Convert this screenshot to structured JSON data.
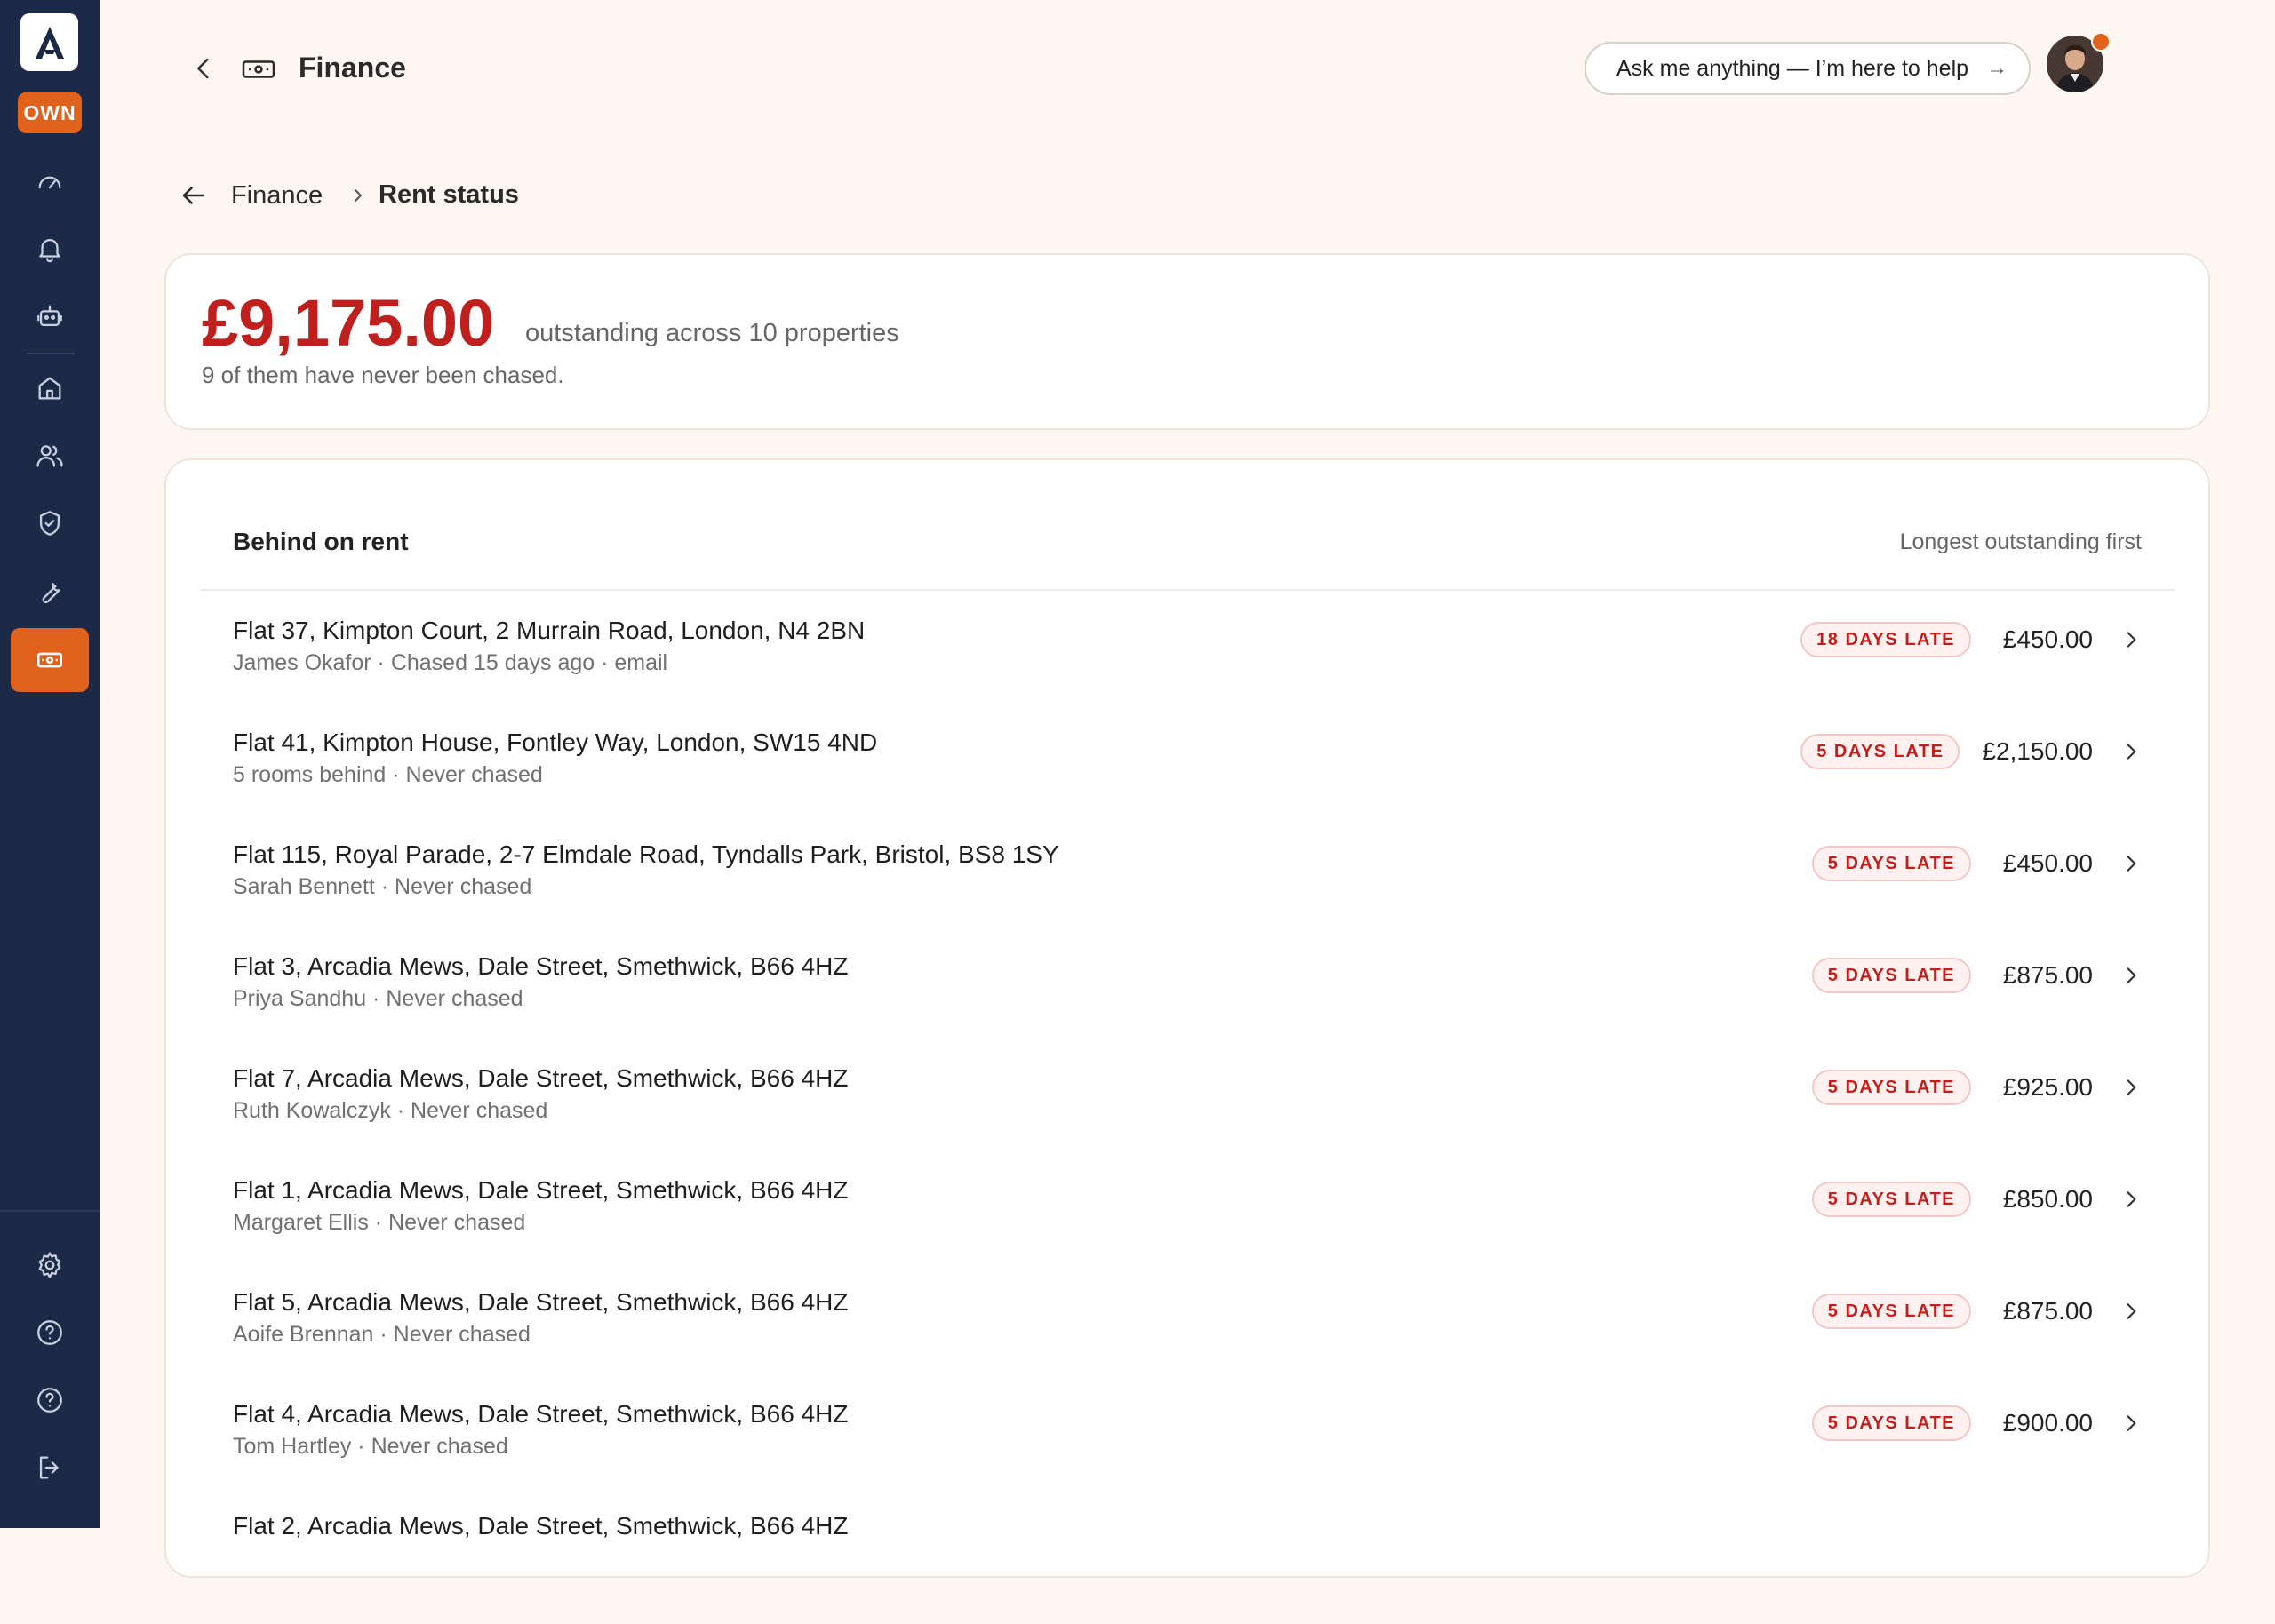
{
  "app": {
    "logo_letter": "A",
    "badge": "OWN"
  },
  "sidebar": {
    "icons": [
      "dashboard-icon",
      "bell-icon",
      "robot-icon",
      "home-icon",
      "people-icon",
      "shield-icon",
      "wrench-icon",
      "money-icon",
      "settings-icon",
      "help-icon",
      "help-icon",
      "logout-icon"
    ],
    "active": "money-icon"
  },
  "header": {
    "title": "Finance",
    "ask_label": "Ask me anything — I’m here to help",
    "ask_arrow": "→"
  },
  "breadcrumb": {
    "parent": "Finance",
    "current": "Rent status"
  },
  "summary": {
    "amount": "£9,175.00",
    "across": "outstanding across 10 properties",
    "note": "9 of them have never been chased."
  },
  "list": {
    "title": "Behind on rent",
    "sort": "Longest outstanding first",
    "rows": [
      {
        "address": "Flat 37, Kimpton Court, 2 Murrain Road, London, N4 2BN",
        "sub": "James Okafor · Chased 15 days ago · email",
        "badge": "18 DAYS LATE",
        "amount": "£450.00"
      },
      {
        "address": "Flat 41, Kimpton House, Fontley Way, London, SW15 4ND",
        "sub": "5 rooms behind · Never chased",
        "badge": "5 DAYS LATE",
        "amount": "£2,150.00"
      },
      {
        "address": "Flat 115, Royal Parade, 2-7 Elmdale Road, Tyndalls Park, Bristol, BS8 1SY",
        "sub": "Sarah Bennett · Never chased",
        "badge": "5 DAYS LATE",
        "amount": "£450.00"
      },
      {
        "address": "Flat 3, Arcadia Mews, Dale Street, Smethwick, B66 4HZ",
        "sub": "Priya Sandhu · Never chased",
        "badge": "5 DAYS LATE",
        "amount": "£875.00"
      },
      {
        "address": "Flat 7, Arcadia Mews, Dale Street, Smethwick, B66 4HZ",
        "sub": "Ruth Kowalczyk · Never chased",
        "badge": "5 DAYS LATE",
        "amount": "£925.00"
      },
      {
        "address": "Flat 1, Arcadia Mews, Dale Street, Smethwick, B66 4HZ",
        "sub": "Margaret Ellis · Never chased",
        "badge": "5 DAYS LATE",
        "amount": "£850.00"
      },
      {
        "address": "Flat 5, Arcadia Mews, Dale Street, Smethwick, B66 4HZ",
        "sub": "Aoife Brennan · Never chased",
        "badge": "5 DAYS LATE",
        "amount": "£875.00"
      },
      {
        "address": "Flat 4, Arcadia Mews, Dale Street, Smethwick, B66 4HZ",
        "sub": "Tom Hartley · Never chased",
        "badge": "5 DAYS LATE",
        "amount": "£900.00"
      },
      {
        "address": "Flat 2, Arcadia Mews, Dale Street, Smethwick, B66 4HZ",
        "sub": "",
        "badge": "",
        "amount": ""
      }
    ]
  }
}
